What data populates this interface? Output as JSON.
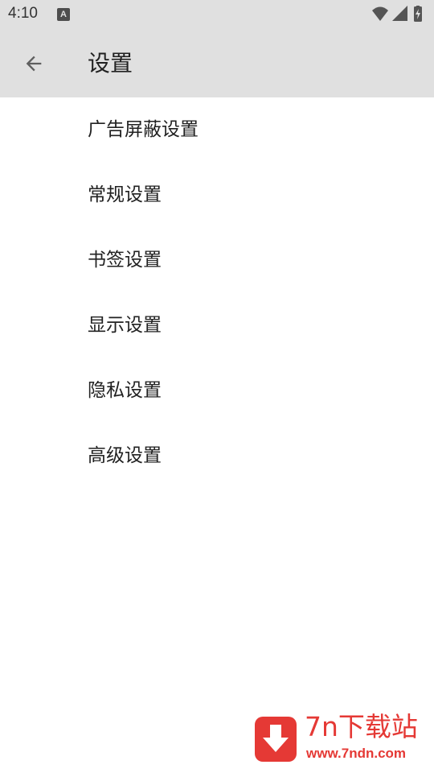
{
  "status_bar": {
    "time": "4:10",
    "notification_glyph": "A",
    "icons": [
      "wifi-icon",
      "cell-signal-icon",
      "battery-charging-icon"
    ]
  },
  "header": {
    "back_icon": "arrow-back-icon",
    "title": "设置"
  },
  "settings": {
    "items": [
      {
        "label": "广告屏蔽设置"
      },
      {
        "label": "常规设置"
      },
      {
        "label": "书签设置"
      },
      {
        "label": "显示设置"
      },
      {
        "label": "隐私设置"
      },
      {
        "label": "高级设置"
      }
    ]
  },
  "watermark": {
    "title": "7n下载站",
    "url": "www.7ndn.com",
    "color": "#e53935"
  },
  "colors": {
    "bar_background": "#e0e0e0",
    "text_primary": "#212121",
    "icon_gray": "#5f5f5f"
  }
}
